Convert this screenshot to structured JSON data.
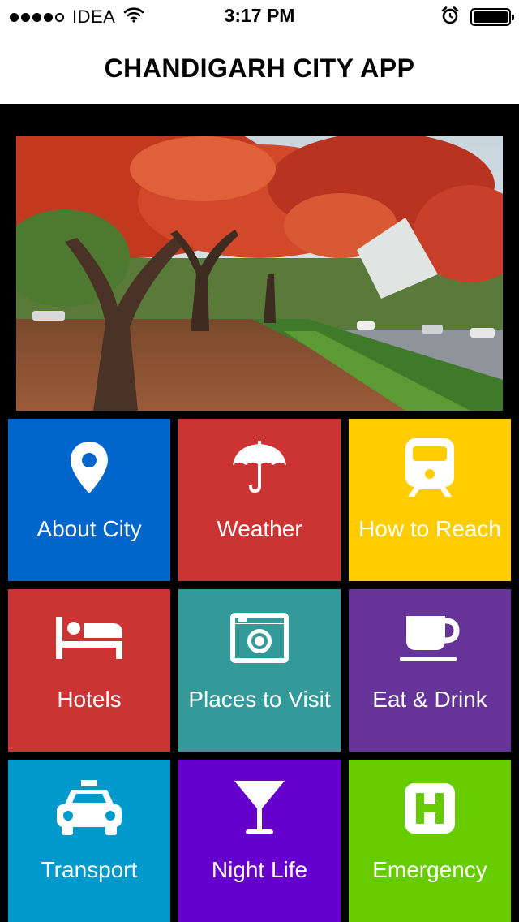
{
  "status_bar": {
    "signal_filled": 4,
    "signal_total": 5,
    "carrier": "IDEA",
    "time": "3:17 PM",
    "icons": [
      "wifi-icon",
      "alarm-clock-icon",
      "battery-icon"
    ]
  },
  "nav": {
    "title": "CHANDIGARH CITY APP"
  },
  "banner": {
    "image": "photo of a tree-lined avenue with red flowering trees and fallen leaves"
  },
  "tiles": [
    {
      "label": "About City",
      "icon": "location-pin-icon",
      "color": "#0066CC"
    },
    {
      "label": "Weather",
      "icon": "umbrella-icon",
      "color": "#CC3333"
    },
    {
      "label": "How to Reach",
      "icon": "train-icon",
      "color": "#FFCC00"
    },
    {
      "label": "Hotels",
      "icon": "bed-icon",
      "color": "#CC3333"
    },
    {
      "label": "Places to Visit",
      "icon": "camera-icon",
      "color": "#339999"
    },
    {
      "label": "Eat & Drink",
      "icon": "coffee-cup-icon",
      "color": "#663399"
    },
    {
      "label": "Transport",
      "icon": "taxi-icon",
      "color": "#0099CC"
    },
    {
      "label": "Night Life",
      "icon": "cocktail-glass-icon",
      "color": "#6600CC"
    },
    {
      "label": "Emergency",
      "icon": "hospital-icon",
      "color": "#66CC00"
    }
  ]
}
